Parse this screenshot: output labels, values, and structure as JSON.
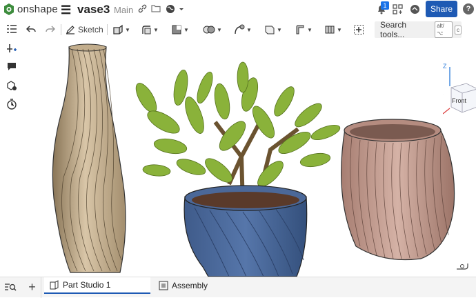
{
  "header": {
    "logo_text": "onshape",
    "doc_name": "vase3",
    "workspace": "Main",
    "notification_count": "1",
    "share_label": "Share",
    "help_label": "?"
  },
  "toolbar": {
    "sketch_label": "Sketch",
    "search_label": "Search tools...",
    "search_shortcut_1": "alt/⌥",
    "search_shortcut_2": "c"
  },
  "viewcube": {
    "face_label": "Front",
    "axis_label": "Z"
  },
  "bottom_tabs": [
    {
      "label": "Part Studio 1"
    },
    {
      "label": "Assembly"
    }
  ],
  "colors": {
    "accent": "#1e5ab4",
    "vase_tall": "#c8b394",
    "pot_blue": "#4a6a9e",
    "bowl_pink": "#c09a8e",
    "plant_green": "#8ab23a"
  }
}
